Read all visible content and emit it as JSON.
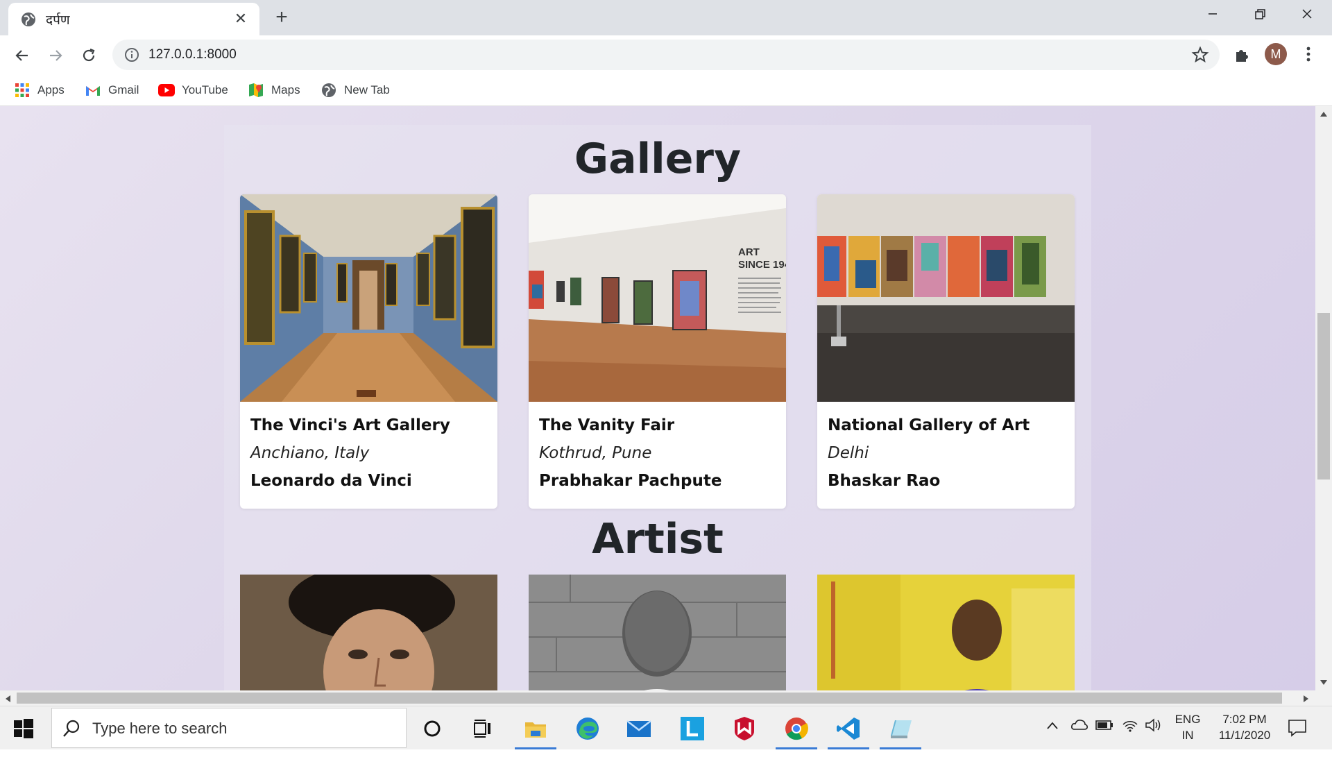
{
  "browser": {
    "tab_title": "दर्पण",
    "new_tab_symbol": "+",
    "url": "127.0.0.1:8000",
    "avatar_letter": "M",
    "bookmarks": [
      {
        "label": "Apps",
        "icon": "apps-grid-icon"
      },
      {
        "label": "Gmail",
        "icon": "gmail-icon"
      },
      {
        "label": "YouTube",
        "icon": "youtube-icon"
      },
      {
        "label": "Maps",
        "icon": "maps-icon"
      },
      {
        "label": "New Tab",
        "icon": "globe-icon"
      }
    ]
  },
  "page": {
    "gallery_title": "Gallery",
    "artist_title": "Artist",
    "galleries": [
      {
        "name": "The Vinci's Art Gallery",
        "location": "Anchiano, Italy",
        "artist": "Leonardo da Vinci"
      },
      {
        "name": "The Vanity Fair",
        "location": "Kothrud, Pune",
        "artist": "Prabhakar Pachpute"
      },
      {
        "name": "National Gallery of Art",
        "location": "Delhi",
        "artist": "Bhaskar Rao"
      }
    ],
    "gallery_image_text": "ART\nSINCE 194"
  },
  "taskbar": {
    "search_placeholder": "Type here to search",
    "language_top": "ENG",
    "language_bottom": "IN",
    "time": "7:02 PM",
    "date": "11/1/2020"
  },
  "colors": {
    "page_bg": "#ddd6ea",
    "card_bg": "#ffffff",
    "title_text": "#212529"
  }
}
